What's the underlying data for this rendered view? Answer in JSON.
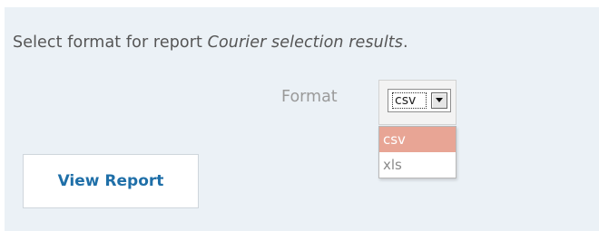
{
  "prompt": {
    "prefix": "Select format for report ",
    "report_name": "Courier selection results",
    "suffix": "."
  },
  "format": {
    "label": "Format",
    "selected_value": "csv",
    "options": [
      "csv",
      "xls"
    ],
    "highlighted_option": "csv"
  },
  "actions": {
    "view_report_label": "View Report"
  },
  "colors": {
    "panel_background": "#ebf1f6",
    "highlight": "#e8a595",
    "button_text": "#1f6fa8"
  },
  "icons": {
    "dropdown": "chevron-down-icon"
  }
}
